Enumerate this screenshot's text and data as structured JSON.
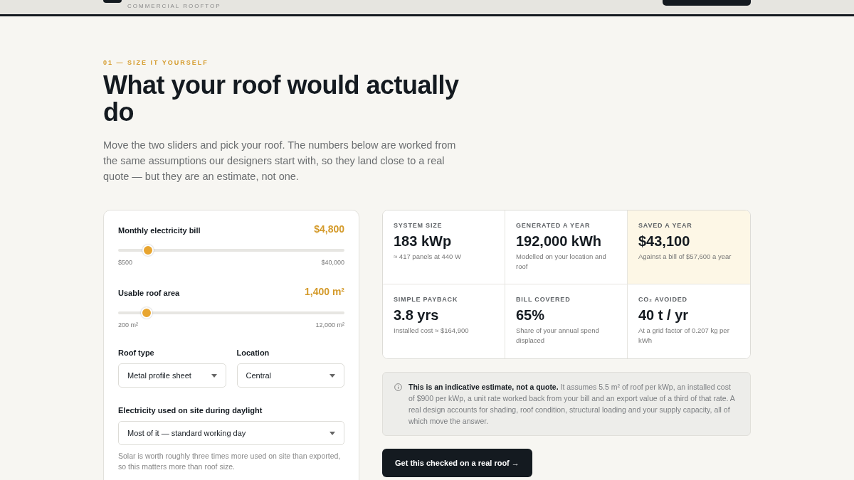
{
  "header": {
    "tagline": "COMMERCIAL ROOFTOP"
  },
  "section": {
    "eyebrow": "01 — SIZE IT YOURSELF",
    "title": "What your roof would actually do",
    "intro": "Move the two sliders and pick your roof. The numbers below are worked from the same assumptions our designers start with, so they land close to a real quote — but they are an estimate, not one."
  },
  "sliders": [
    {
      "label": "Monthly electricity bill",
      "value": "$4,800",
      "level": 0.126,
      "min": "$500",
      "max": "$40,000"
    },
    {
      "label": "Usable roof area",
      "value": "1,400 m²",
      "level": 0.12,
      "min": "200 m²",
      "max": "12,000 m²"
    }
  ],
  "selects": [
    {
      "label": "Roof type",
      "value": "Metal profile sheet"
    },
    {
      "label": "Location",
      "value": "Central"
    }
  ],
  "daylight": {
    "label": "Electricity used on site during daylight",
    "value": "Most of it — standard working day",
    "hint": "Solar is worth roughly three times more used on site than exported, so this matters more than roof size."
  },
  "stats": [
    {
      "label": "SYSTEM SIZE",
      "value": "183 kWp",
      "note": "≈ 417 panels at 440 W",
      "highlighted": false
    },
    {
      "label": "GENERATED A YEAR",
      "value": "192,000 kWh",
      "note": "Modelled on your location and roof",
      "highlighted": false
    },
    {
      "label": "SAVED A YEAR",
      "value": "$43,100",
      "note": "Against a bill of $57,600 a year",
      "highlighted": true
    },
    {
      "label": "SIMPLE PAYBACK",
      "value": "3.8 yrs",
      "note": "Installed cost ≈ $164,900",
      "highlighted": false
    },
    {
      "label": "BILL COVERED",
      "value": "65%",
      "note": "Share of your annual spend displaced",
      "highlighted": false
    },
    {
      "label": "CO₂ AVOIDED",
      "value": "40 t / yr",
      "note": "At a grid factor of 0.207 kg per kWh",
      "highlighted": false
    }
  ],
  "notice": "**This is an indicative estimate, not a quote.** It assumes 5.5 m² of roof per kWp, an installed cost of $900 per kWp, a unit rate worked back from your bill and an export value of a third of that rate. A real design accounts for shading, roof condition, structural loading and your supply capacity, all of which move the answer.",
  "cta": "Get this checked on a real roof →"
}
